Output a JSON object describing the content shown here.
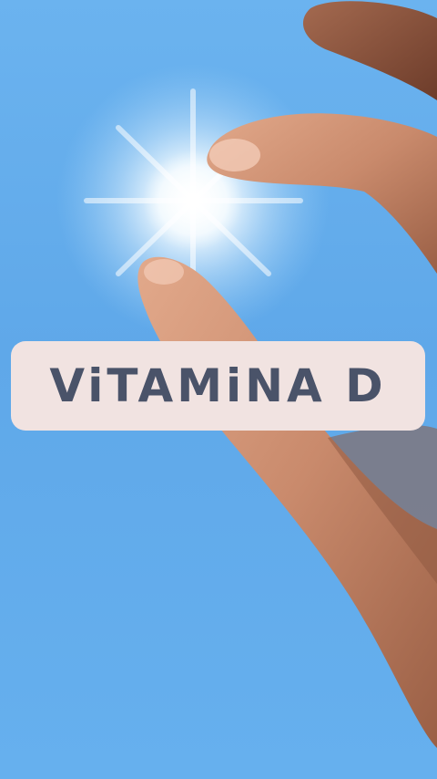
{
  "overlay": {
    "title": "ViTAMiNA D"
  },
  "colors": {
    "sky": "#5fa8e9",
    "label_bg": "#f1e3e1",
    "label_text": "#4a5369",
    "skin": "#c98a6c"
  },
  "icons": {
    "sun": "sun-icon"
  }
}
